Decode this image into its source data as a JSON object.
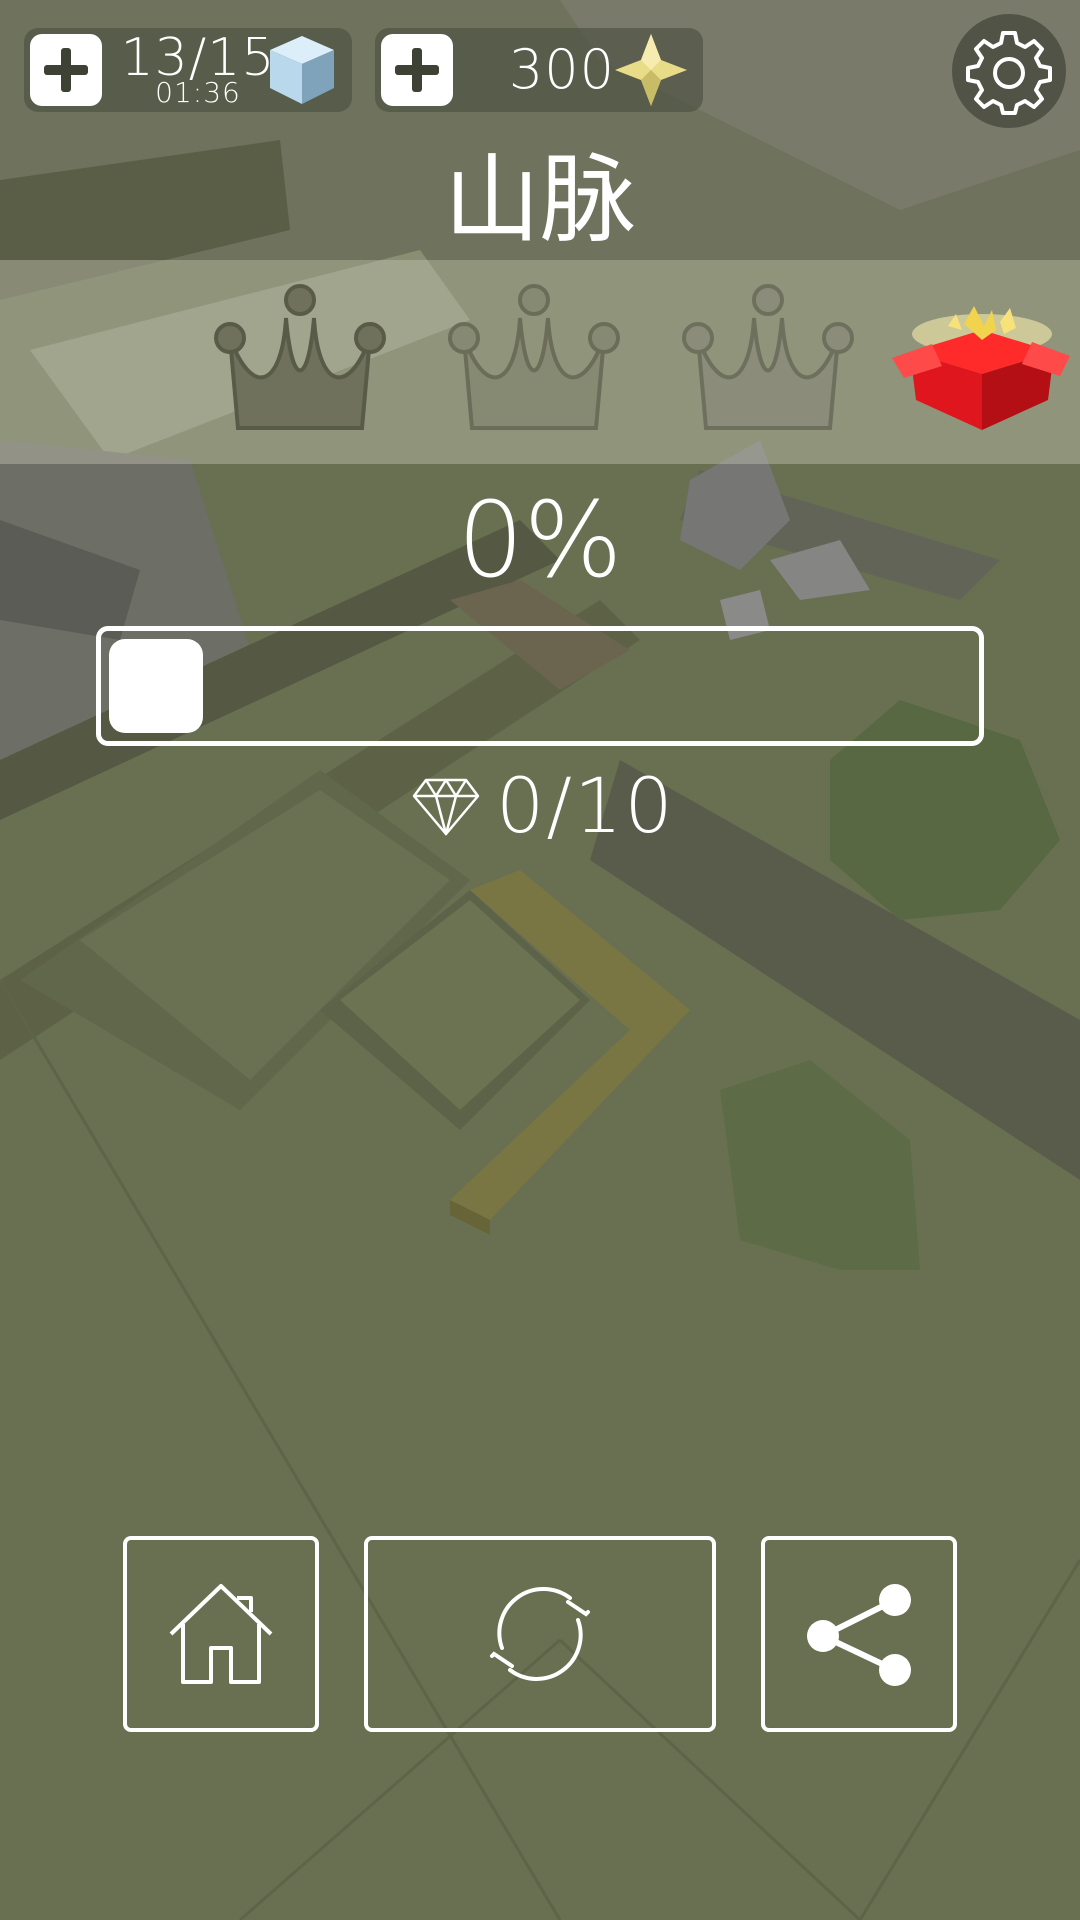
{
  "hud": {
    "energy": {
      "count": "13/15",
      "timer": "01:36",
      "icon": "ice-cube-icon",
      "add_icon": "plus-icon"
    },
    "stars": {
      "count": "300",
      "icon": "sparkle-star-icon",
      "add_icon": "plus-icon"
    },
    "settings_icon": "gear-icon"
  },
  "level": {
    "title": "山脉"
  },
  "crowns": {
    "earned": 0,
    "total": 3,
    "icon": "crown-icon",
    "reward_icon": "gift-box-icon"
  },
  "progress": {
    "label": "0%",
    "value": 0
  },
  "gems": {
    "label": "0/10",
    "collected": 0,
    "total": 10,
    "icon": "diamond-icon"
  },
  "buttons": {
    "home_icon": "home-icon",
    "restart_icon": "restart-icon",
    "share_icon": "share-icon"
  },
  "colors": {
    "ground": "#6b7353",
    "path": "#7d7a44",
    "tree": "#5a6b45",
    "rock": "#777777",
    "gift_red": "#e0161e",
    "star_gold": "#e8dc88",
    "cube_blue": "#b9d8ec"
  }
}
